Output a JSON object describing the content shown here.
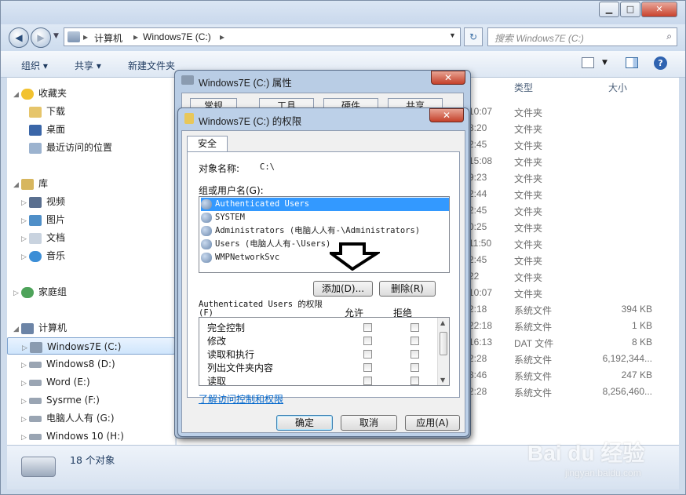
{
  "explorer": {
    "window_buttons": {
      "minimize": "▁",
      "maximize": "□",
      "close": "✕"
    },
    "breadcrumb": [
      "计算机",
      "Windows7E (C:)"
    ],
    "search_placeholder": "搜索 Windows7E (C:)",
    "commands": {
      "organize": "组织 ▾",
      "share": "共享 ▾",
      "new_folder": "新建文件夹"
    },
    "nav": {
      "favorites": "收藏夹",
      "downloads": "下载",
      "desktop": "桌面",
      "recent": "最近访问的位置",
      "libraries": "库",
      "videos": "视频",
      "pictures": "图片",
      "documents": "文档",
      "music": "音乐",
      "homegroup": "家庭组",
      "computer": "计算机",
      "drives": [
        "Windows7E (C:)",
        "Windows8 (D:)",
        "Word (E:)",
        "Sysrme (F:)",
        "电脑人人有 (G:)",
        "Windows 10 (H:)"
      ]
    },
    "columns": {
      "type": "类型",
      "size": "大小"
    },
    "rows": [
      {
        "time": "10:07",
        "type": "文件夹",
        "size": ""
      },
      {
        "time": "8:20",
        "type": "文件夹",
        "size": ""
      },
      {
        "time": "2:45",
        "type": "文件夹",
        "size": ""
      },
      {
        "time": "15:08",
        "type": "文件夹",
        "size": ""
      },
      {
        "time": "9:23",
        "type": "文件夹",
        "size": ""
      },
      {
        "time": "2:44",
        "type": "文件夹",
        "size": ""
      },
      {
        "time": "2:45",
        "type": "文件夹",
        "size": ""
      },
      {
        "time": "0:25",
        "type": "文件夹",
        "size": ""
      },
      {
        "time": "11:50",
        "type": "文件夹",
        "size": ""
      },
      {
        "time": "2:45",
        "type": "文件夹",
        "size": ""
      },
      {
        "time": "22",
        "type": "文件夹",
        "size": ""
      },
      {
        "time": "10:07",
        "type": "文件夹",
        "size": ""
      },
      {
        "time": "2:18",
        "type": "系统文件",
        "size": "394 KB"
      },
      {
        "time": "22:18",
        "type": "系统文件",
        "size": "1 KB"
      },
      {
        "time": "16:13",
        "type": "DAT 文件",
        "size": "8 KB"
      },
      {
        "time": "2:28",
        "type": "系统文件",
        "size": "6,192,344..."
      },
      {
        "time": "8:46",
        "type": "系统文件",
        "size": "247 KB"
      },
      {
        "time": "2:28",
        "type": "系统文件",
        "size": "8,256,460..."
      }
    ],
    "status": "18 个对象"
  },
  "props_dialog": {
    "title": "Windows7E (C:) 属性",
    "tabs": [
      "常规",
      "工具",
      "硬件",
      "共享"
    ]
  },
  "perm_dialog": {
    "title": "Windows7E (C:) 的权限",
    "tab": "安全",
    "object_label": "对象名称:",
    "object_value": "C:\\",
    "group_label": "组或用户名(G):",
    "users": [
      "Authenticated Users",
      "SYSTEM",
      "Administrators (电脑人人有-\\Administrators)",
      "Users (电脑人人有-\\Users)",
      "WMPNetworkSvc"
    ],
    "add_button": "添加(D)...",
    "remove_button": "删除(R)",
    "perm_header": "Authenticated Users 的权限",
    "perm_header_key": "(F)",
    "allow": "允许",
    "deny": "拒绝",
    "permissions": [
      "完全控制",
      "修改",
      "读取和执行",
      "列出文件夹内容",
      "读取"
    ],
    "link": "了解访问控制和权限",
    "ok": "确定",
    "cancel": "取消",
    "apply": "应用(A)"
  },
  "watermark": {
    "brand": "Bai du 经验",
    "url": "jingyan.baidu.com"
  }
}
